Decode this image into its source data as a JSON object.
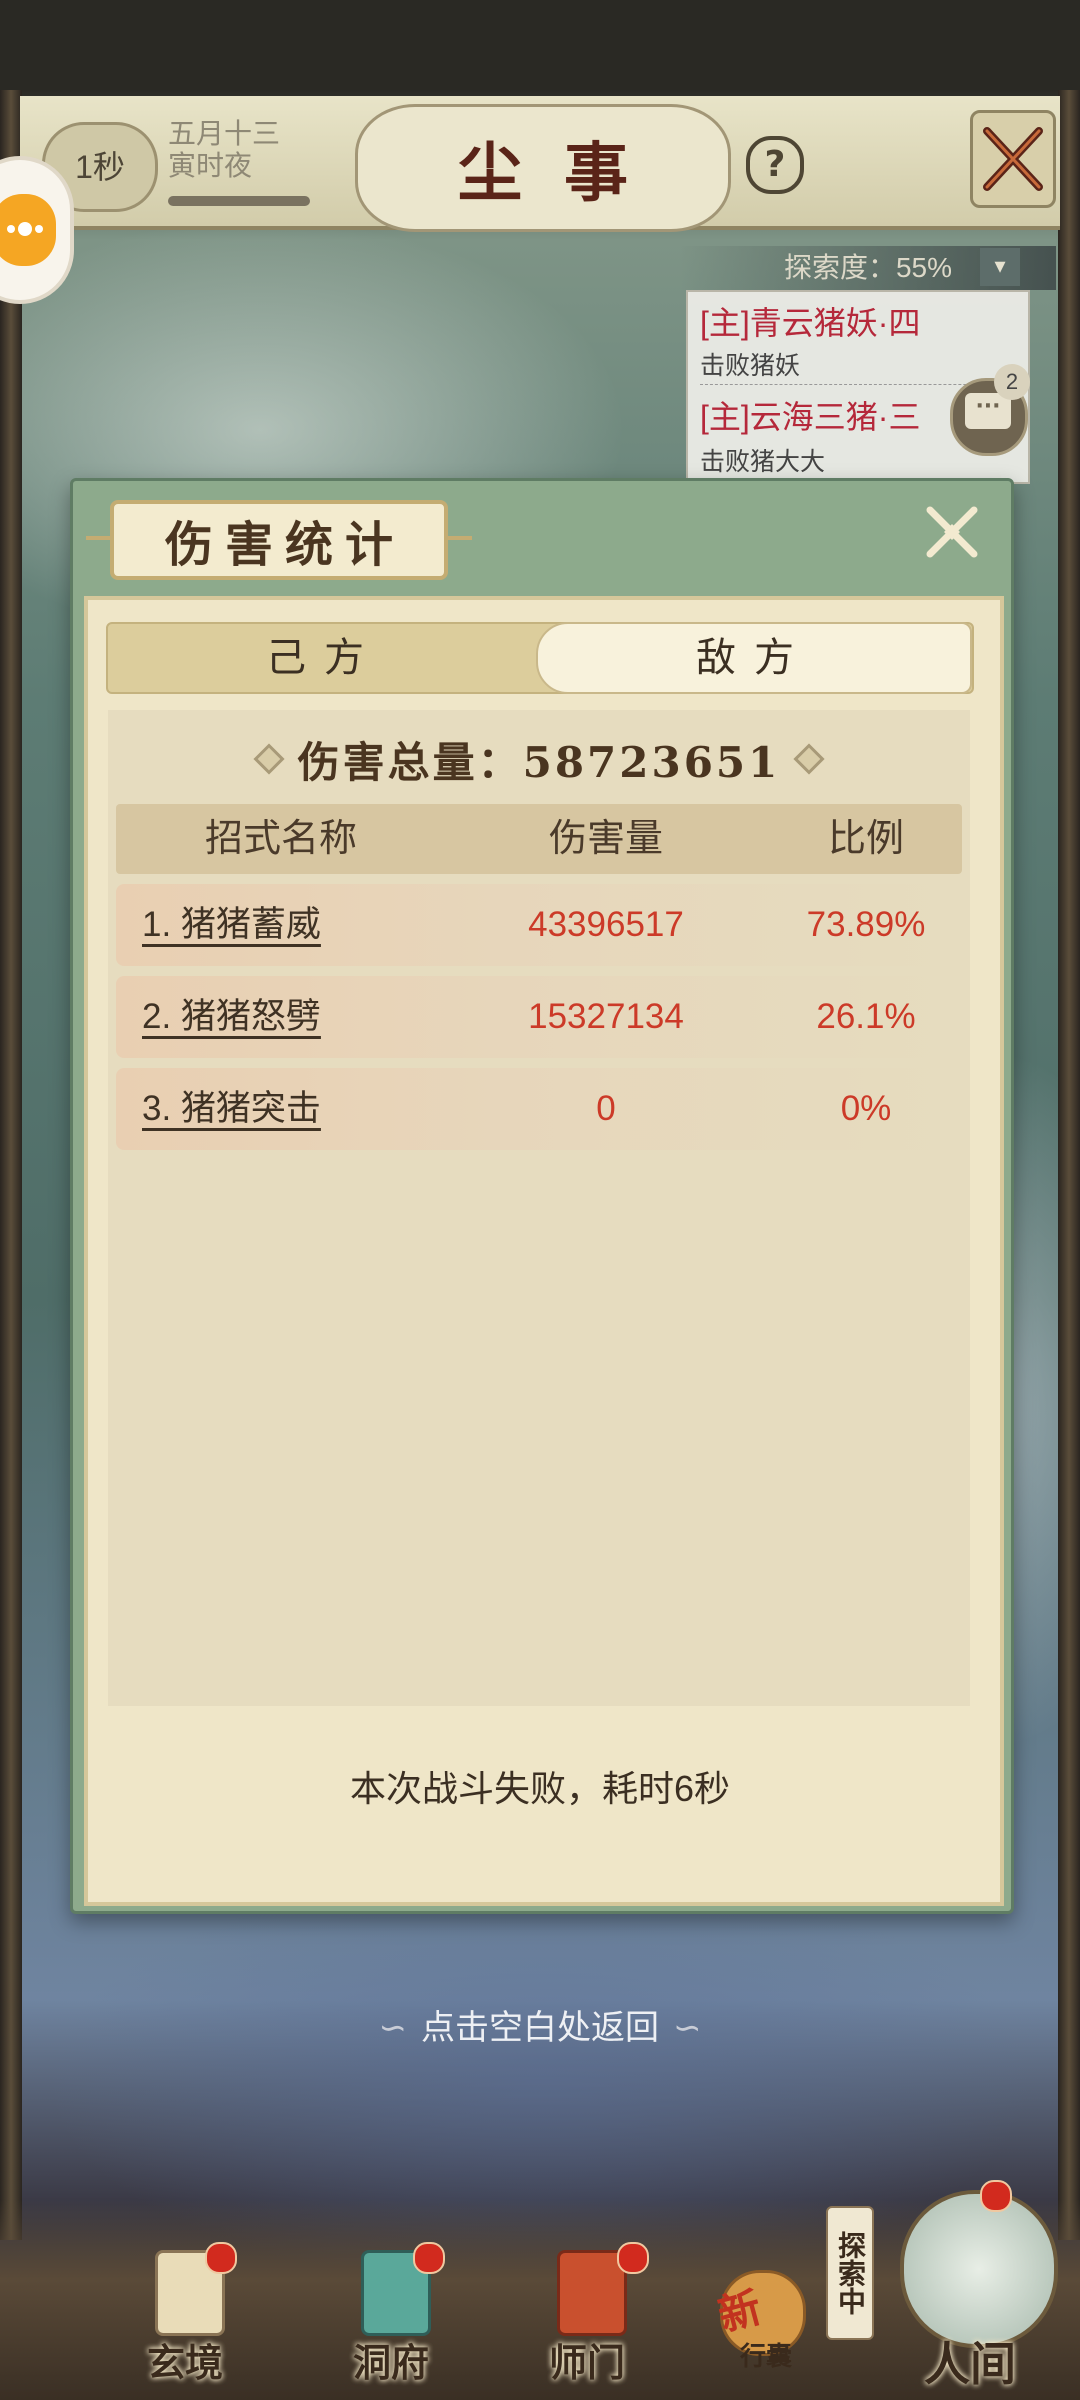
{
  "header": {
    "timer": "1秒",
    "date_line1": "五月十三",
    "date_line2": "寅时夜",
    "title": "尘事",
    "help_icon": "question-icon",
    "close_icon": "close-icon"
  },
  "quests": {
    "explore_label": "探索度：55%",
    "items": [
      {
        "title": "[主]青云猪妖·四",
        "desc": "击败猪妖"
      },
      {
        "title": "[主]云海三猪·三",
        "desc": "击败猪大大"
      }
    ],
    "chat_count": "2"
  },
  "dialog": {
    "title": "伤害统计",
    "tabs": [
      {
        "label": "己方",
        "active": false
      },
      {
        "label": "敌方",
        "active": true
      }
    ],
    "total": "伤害总量：58723651",
    "columns": [
      "招式名称",
      "伤害量",
      "比例"
    ],
    "rows": [
      {
        "name": "1. 猪猪蓄威",
        "damage": "43396517",
        "ratio": "73.89%"
      },
      {
        "name": "2. 猪猪怒劈",
        "damage": "15327134",
        "ratio": "26.1%"
      },
      {
        "name": "3. 猪猪突击",
        "damage": "0",
        "ratio": "0%"
      }
    ],
    "result": "本次战斗失败，耗时6秒"
  },
  "tap_return": "点击空白处返回",
  "bottom_nav": {
    "items": [
      {
        "label": "玄境",
        "icon": "scroll-icon"
      },
      {
        "label": "洞府",
        "icon": "lantern-icon"
      },
      {
        "label": "师门",
        "icon": "banner-icon"
      }
    ],
    "xingnang_new": "新",
    "xingnang_label": "行囊",
    "explore_tag": "探索中",
    "main_label": "人间"
  },
  "colors": {
    "damage_red": "#cc3a28",
    "quest_red": "#b5283a",
    "dialog_green": "#8daa8c",
    "panel_cream": "#efe6c8"
  }
}
